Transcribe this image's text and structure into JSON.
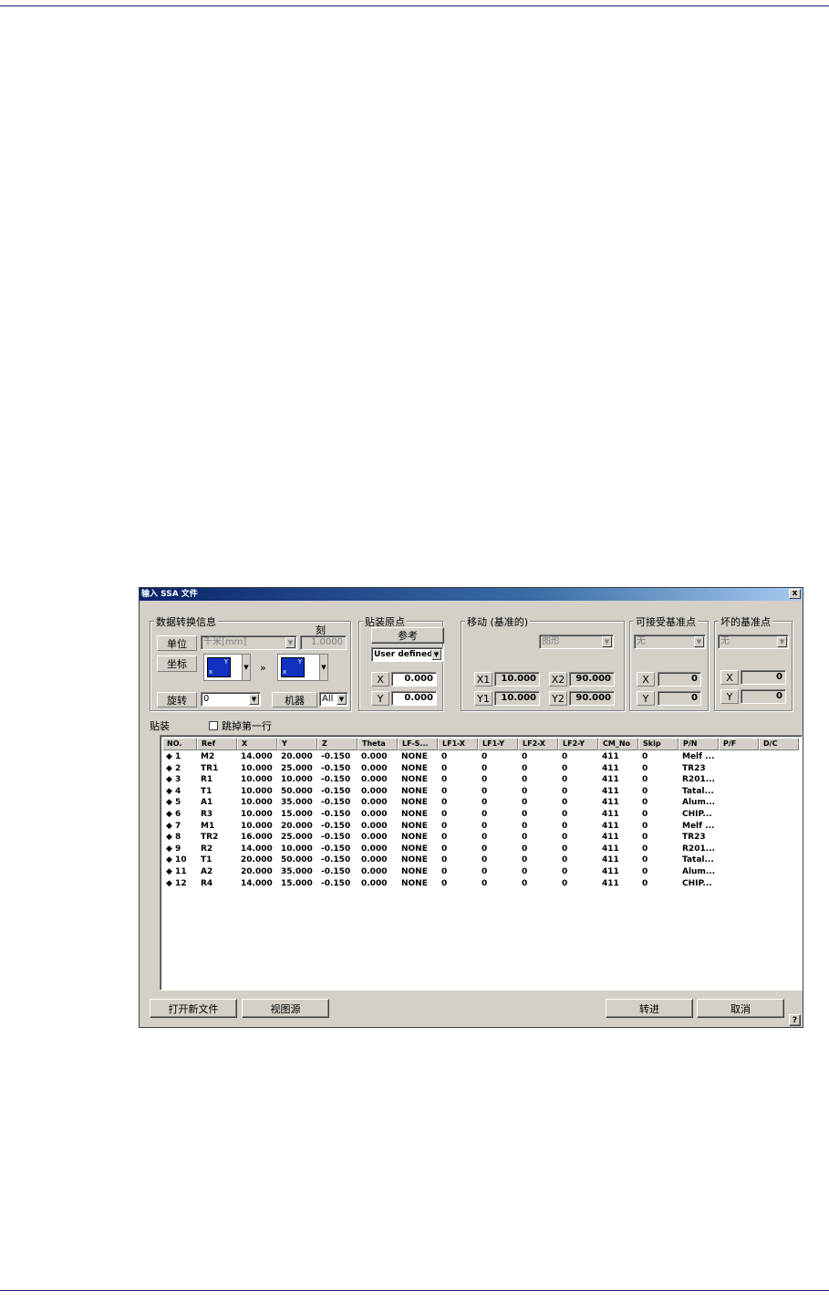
{
  "dialog": {
    "title": "输入 SSA 文件",
    "close_label": "x",
    "help_label": "?"
  },
  "conversion": {
    "legend": "数据转换信息",
    "scale_label": "刻",
    "unit_label": "单位",
    "unit_value": "千米[mm]",
    "scale_value": "1.0000",
    "coord_label": "坐标",
    "coord_arrow": "»",
    "rotate_label": "旋转",
    "rotate_value": "0",
    "machine_label": "机器",
    "machine_value": "All"
  },
  "origin": {
    "legend": "贴装原点",
    "reference_button": "参考",
    "mode_value": "User defined",
    "x_label": "X",
    "x_value": "0.000",
    "y_label": "Y",
    "y_value": "0.000"
  },
  "move": {
    "legend": "移动 (基准的)",
    "shape_value": "图形",
    "x1_label": "X1",
    "x1_value": "10.000",
    "x2_label": "X2",
    "x2_value": "90.000",
    "y1_label": "Y1",
    "y1_value": "10.000",
    "y2_label": "Y2",
    "y2_value": "90.000"
  },
  "accept_fiducial": {
    "legend": "可接受基准点",
    "value": "无",
    "x_label": "X",
    "x_value": "0",
    "y_label": "Y",
    "y_value": "0"
  },
  "bad_fiducial": {
    "legend": "坏的基准点",
    "value": "无",
    "x_label": "X",
    "x_value": "0",
    "y_label": "Y",
    "y_value": "0"
  },
  "placement": {
    "label": "贴装",
    "skip_first_row_label": "跳掉第一行",
    "skip_first_row_checked": false
  },
  "table": {
    "columns": [
      "NO.",
      "Ref",
      "X",
      "Y",
      "Z",
      "Theta",
      "LF-S...",
      "LF1-X",
      "LF1-Y",
      "LF2-X",
      "LF2-Y",
      "CM_No",
      "Skip",
      "P/N",
      "P/F",
      "D/C"
    ],
    "rows": [
      [
        "◆ 1",
        "M2",
        "14.000",
        "20.000",
        "-0.150",
        "0.000",
        "NONE",
        "0",
        "0",
        "0",
        "0",
        "411",
        "0",
        "Melf ...",
        "",
        ""
      ],
      [
        "◆ 2",
        "TR1",
        "10.000",
        "25.000",
        "-0.150",
        "0.000",
        "NONE",
        "0",
        "0",
        "0",
        "0",
        "411",
        "0",
        "TR23",
        "",
        ""
      ],
      [
        "◆ 3",
        "R1",
        "10.000",
        "10.000",
        "-0.150",
        "0.000",
        "NONE",
        "0",
        "0",
        "0",
        "0",
        "411",
        "0",
        "R201...",
        "",
        ""
      ],
      [
        "◆ 4",
        "T1",
        "10.000",
        "50.000",
        "-0.150",
        "0.000",
        "NONE",
        "0",
        "0",
        "0",
        "0",
        "411",
        "0",
        "Tatal...",
        "",
        ""
      ],
      [
        "◆ 5",
        "A1",
        "10.000",
        "35.000",
        "-0.150",
        "0.000",
        "NONE",
        "0",
        "0",
        "0",
        "0",
        "411",
        "0",
        "Alum...",
        "",
        ""
      ],
      [
        "◆ 6",
        "R3",
        "10.000",
        "15.000",
        "-0.150",
        "0.000",
        "NONE",
        "0",
        "0",
        "0",
        "0",
        "411",
        "0",
        "CHIP...",
        "",
        ""
      ],
      [
        "◆ 7",
        "M1",
        "10.000",
        "20.000",
        "-0.150",
        "0.000",
        "NONE",
        "0",
        "0",
        "0",
        "0",
        "411",
        "0",
        "Melf ...",
        "",
        ""
      ],
      [
        "◆ 8",
        "TR2",
        "16.000",
        "25.000",
        "-0.150",
        "0.000",
        "NONE",
        "0",
        "0",
        "0",
        "0",
        "411",
        "0",
        "TR23",
        "",
        ""
      ],
      [
        "◆ 9",
        "R2",
        "14.000",
        "10.000",
        "-0.150",
        "0.000",
        "NONE",
        "0",
        "0",
        "0",
        "0",
        "411",
        "0",
        "R201...",
        "",
        ""
      ],
      [
        "◆ 10",
        "T1",
        "20.000",
        "50.000",
        "-0.150",
        "0.000",
        "NONE",
        "0",
        "0",
        "0",
        "0",
        "411",
        "0",
        "Tatal...",
        "",
        ""
      ],
      [
        "◆ 11",
        "A2",
        "20.000",
        "35.000",
        "-0.150",
        "0.000",
        "NONE",
        "0",
        "0",
        "0",
        "0",
        "411",
        "0",
        "Alum...",
        "",
        ""
      ],
      [
        "◆ 12",
        "R4",
        "14.000",
        "15.000",
        "-0.150",
        "0.000",
        "NONE",
        "0",
        "0",
        "0",
        "0",
        "411",
        "0",
        "CHIP...",
        "",
        ""
      ]
    ]
  },
  "buttons": {
    "open_new_file": "打开新文件",
    "view_source": "视图源",
    "proceed": "转进",
    "cancel": "取消"
  }
}
